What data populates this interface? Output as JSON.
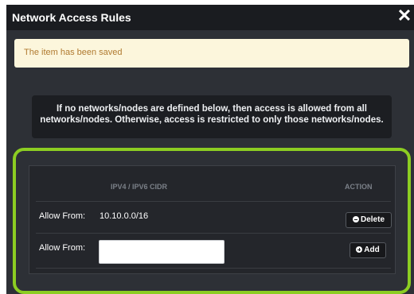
{
  "dialog": {
    "title": "Network Access Rules",
    "close_symbol": "✕"
  },
  "alert": {
    "message": "The item has been saved"
  },
  "info": {
    "message": "If no networks/nodes are defined below, then access is allowed from all networks/nodes. Otherwise, access is restricted to only those networks/nodes."
  },
  "table": {
    "columns": {
      "cidr": "IPV4 / IPV6 CIDR",
      "action": "ACTION"
    },
    "rows": [
      {
        "label": "Allow From:",
        "value": "10.10.0.0/16",
        "action_label": "Delete"
      }
    ],
    "new_row": {
      "label": "Allow From:",
      "value": "",
      "placeholder": "",
      "action_label": "Add"
    }
  },
  "colors": {
    "highlight_border": "#8ccd22",
    "alert_background": "#fcf6dc",
    "alert_text": "#b07a30",
    "dialog_background": "#2d3036"
  },
  "icons": {
    "close": "close-icon",
    "delete": "minus-circle-icon",
    "add": "plus-circle-icon"
  }
}
